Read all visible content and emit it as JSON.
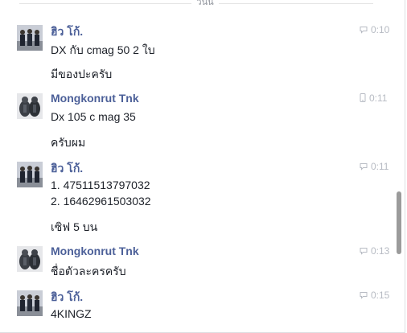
{
  "date_divider": {
    "label": "วันนี้"
  },
  "messages": [
    {
      "sender": "ฮิว โก้.",
      "time": "0:10",
      "time_icon": "speech-bubble-icon",
      "lines": [
        "DX กับ cmag 50 2 ใบ",
        "มีของปะครับ"
      ]
    },
    {
      "sender": "Mongkonrut Tnk",
      "time": "0:11",
      "time_icon": "mobile-phone-icon",
      "lines": [
        "Dx 105 c mag 35",
        "ครับผม"
      ]
    },
    {
      "sender": "ฮิว โก้.",
      "time": "0:11",
      "time_icon": "speech-bubble-icon",
      "lines": [
        "1. 47511513797032",
        "2. 16462961503032",
        "เซิฟ 5 บน"
      ]
    },
    {
      "sender": "Mongkonrut Tnk",
      "time": "0:13",
      "time_icon": "speech-bubble-icon",
      "lines": [
        "ชื่อตัวละครครับ"
      ]
    },
    {
      "sender": "ฮิว โก้.",
      "time": "0:15",
      "time_icon": "speech-bubble-icon",
      "lines": [
        "4KINGZ"
      ]
    }
  ],
  "colors": {
    "sender_name": "#4b5f98",
    "timestamp": "#b7bbc3",
    "message_text": "#1d2129",
    "scrollbar_thumb": "#9b9b9b"
  }
}
